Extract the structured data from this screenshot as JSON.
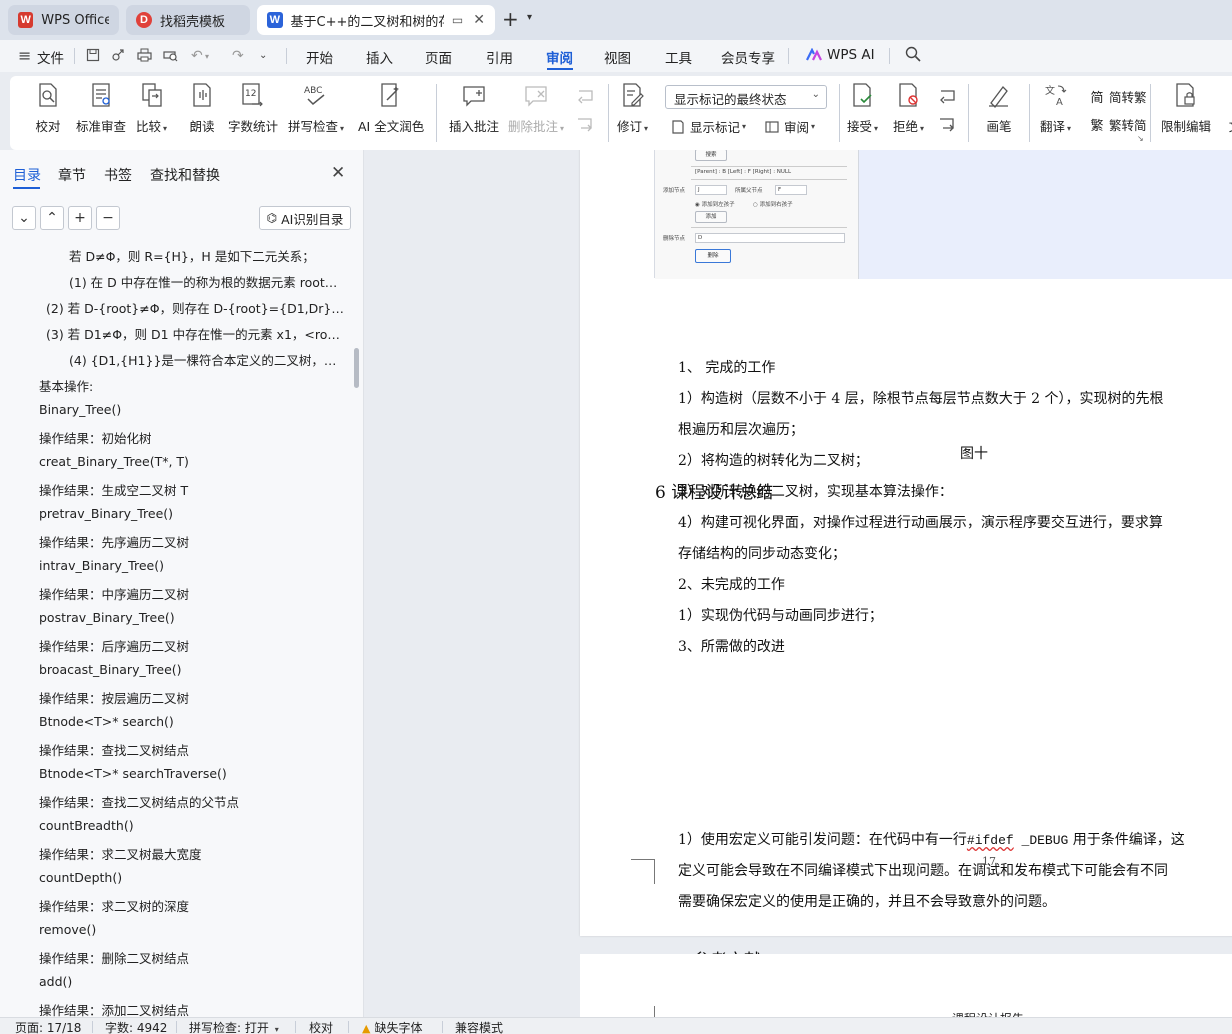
{
  "tabs": [
    {
      "label": "WPS Office",
      "icon": "wps-logo-icon"
    },
    {
      "label": "找稻壳模板",
      "icon": "docer-icon"
    },
    {
      "label": "基于C++的二叉树和树的存储",
      "icon": "word-doc-icon"
    }
  ],
  "menu": {
    "file": "文件",
    "items": [
      "开始",
      "插入",
      "页面",
      "引用",
      "审阅",
      "视图",
      "工具",
      "会员专享"
    ],
    "active": "审阅",
    "ai": "WPS AI"
  },
  "ribbon": {
    "proofread": "校对",
    "standard_review": "标准审查",
    "compare": "比较",
    "read_aloud": "朗读",
    "word_count": "字数统计",
    "spell_check": "拼写检查",
    "ai_polish": "AI 全文润色",
    "insert_comment": "插入批注",
    "delete_comment": "删除批注",
    "track_changes": "修订",
    "markup_view": "显示标记的最终状态",
    "show_markup": "显示标记",
    "review_pane": "审阅",
    "accept": "接受",
    "reject": "拒绝",
    "ink": "画笔",
    "translate": "翻译",
    "to_traditional": "简转繁",
    "to_simplified": "繁转简",
    "restrict_edit": "限制编辑",
    "doc_cut": "文"
  },
  "sidebar": {
    "tabs": [
      "目录",
      "章节",
      "书签",
      "查找和替换"
    ],
    "ai_button": "AI识别目录",
    "toc": [
      {
        "text": "若 D≠Φ，则 R={H}，H 是如下二元关系；",
        "indent": 2
      },
      {
        "text": "(1) 在 D 中存在惟一的称为根的数据元素 root，…",
        "indent": 2
      },
      {
        "text": "(2) 若 D-{root}≠Φ，则存在 D-{root}={D1,Dr}，且 …",
        "indent": 1
      },
      {
        "text": "(3) 若 D1≠Φ，则 D1 中存在惟一的元素 x1，<root…",
        "indent": 1
      },
      {
        "text": "(4) {D1,{H1}}是一棵符合本定义的二叉树，称为 …",
        "indent": 2
      },
      {
        "text": "基本操作:",
        "indent": 0
      },
      {
        "text": "Binary_Tree()",
        "indent": 0
      },
      {
        "text": "操作结果：初始化树",
        "indent": 0
      },
      {
        "text": "creat_Binary_Tree(T*, T)",
        "indent": 0
      },
      {
        "text": "操作结果：生成空二叉树 T",
        "indent": 0
      },
      {
        "text": "pretrav_Binary_Tree()",
        "indent": 0
      },
      {
        "text": "操作结果：先序遍历二叉树",
        "indent": 0
      },
      {
        "text": "intrav_Binary_Tree()",
        "indent": 0
      },
      {
        "text": "操作结果：中序遍历二叉树",
        "indent": 0
      },
      {
        "text": "postrav_Binary_Tree()",
        "indent": 0
      },
      {
        "text": "操作结果：后序遍历二叉树",
        "indent": 0
      },
      {
        "text": "broacast_Binary_Tree()",
        "indent": 0
      },
      {
        "text": "操作结果：按层遍历二叉树",
        "indent": 0
      },
      {
        "text": "Btnode<T>* search()",
        "indent": 0
      },
      {
        "text": "操作结果：查找二叉树结点",
        "indent": 0
      },
      {
        "text": "Btnode<T>* searchTraverse()",
        "indent": 0
      },
      {
        "text": "操作结果：查找二叉树结点的父节点",
        "indent": 0
      },
      {
        "text": "countBreadth()",
        "indent": 0
      },
      {
        "text": "操作结果：求二叉树最大宽度",
        "indent": 0
      },
      {
        "text": "countDepth()",
        "indent": 0
      },
      {
        "text": "操作结果：求二叉树的深度",
        "indent": 0
      },
      {
        "text": "remove()",
        "indent": 0
      },
      {
        "text": "操作结果：删除二叉树结点",
        "indent": 0
      },
      {
        "text": "add()",
        "indent": 0
      },
      {
        "text": "操作结果：添加二叉树结点",
        "indent": 0
      }
    ]
  },
  "document": {
    "screenshot": {
      "search_btn": "搜索",
      "parent_line": "[Parent] : B [Left] : F [Right] : NULL",
      "add_label": "添加节点",
      "add_value": "J",
      "parent_label": "所属父节点",
      "parent_value": "F",
      "left_child": "添加到左孩子",
      "right_child": "添加到右孩子",
      "add_btn": "添加",
      "delete_label": "删除节点",
      "delete_value": "D",
      "delete_btn": "删除"
    },
    "figure_caption": "图十",
    "section_heading": "6 课程设计总结",
    "lines": [
      "1、  完成的工作",
      "1）构造树（层数不小于 4 层，除根节点每层节点数大于 2 个），实现树的先根",
      "根遍历和层次遍历；",
      "2）将构造的树转化为二叉树；",
      " 3）对所转换的二叉树，实现基本算法操作：",
      "4）构建可视化界面，对操作过程进行动画展示，演示程序要交互进行，要求算",
      "存储结构的同步动态变化；",
      "2、未完成的工作",
      "1）实现伪代码与动画同步进行；",
      "3、所需做的改进"
    ],
    "improve_pre": "1）使用宏定义可能引发问题：在代码中有一行",
    "improve_code_a": "#ifdef",
    "improve_code_b": " _DEBUG",
    "improve_post": " 用于条件编译，这",
    "improve_line2": "定义可能会导致在不同编译模式下出现问题。在调试和发布模式下可能会有不同",
    "improve_line3": "需要确保宏定义的使用是正确的，并且不会导致意外的问题。",
    "references_heading": "参考文献",
    "page_number": "17",
    "next_page_header": "课程设计报告"
  },
  "status": {
    "page": "页面: 17/18",
    "words": "字数: 4942",
    "spell": "拼写检查: 打开",
    "proofread": "校对",
    "missing_font": "缺失字体",
    "compat": "兼容模式"
  },
  "colors": {
    "accent": "#1e5fd6",
    "wps_red": "#d63a2f",
    "word_blue": "#2b63d9"
  }
}
